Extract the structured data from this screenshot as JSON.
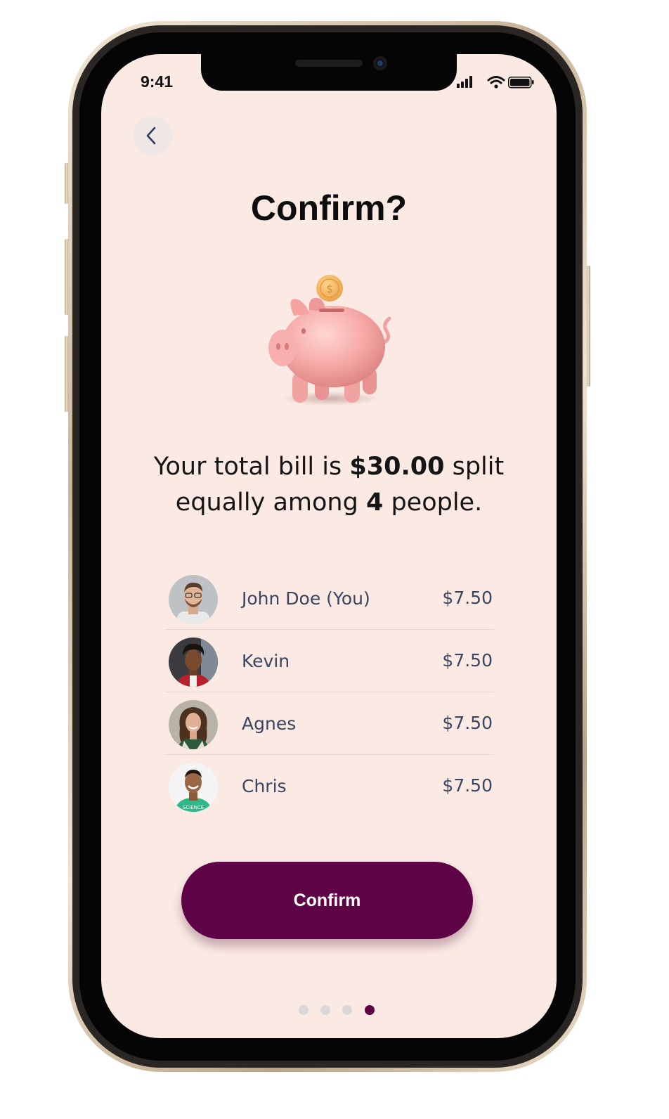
{
  "status_bar": {
    "time": "9:41"
  },
  "header": {
    "title": "Confirm?"
  },
  "summary": {
    "prefix": "Your total bill is",
    "total": "$30.00",
    "middle": "split equally among",
    "count": "4",
    "suffix": "people."
  },
  "people": [
    {
      "name": "John Doe (You)",
      "amount": "$7.50"
    },
    {
      "name": "Kevin",
      "amount": "$7.50"
    },
    {
      "name": "Agnes",
      "amount": "$7.50"
    },
    {
      "name": "Chris",
      "amount": "$7.50"
    }
  ],
  "confirm_button": {
    "label": "Confirm"
  },
  "pagination": {
    "total": 4,
    "current": 4
  },
  "colors": {
    "accent": "#5f0347",
    "background": "#fbe9e3",
    "text_secondary": "#3a4560"
  },
  "icons": {
    "back": "chevron-left-icon",
    "illustration": "piggy-bank-icon",
    "coin": "coin-icon"
  }
}
